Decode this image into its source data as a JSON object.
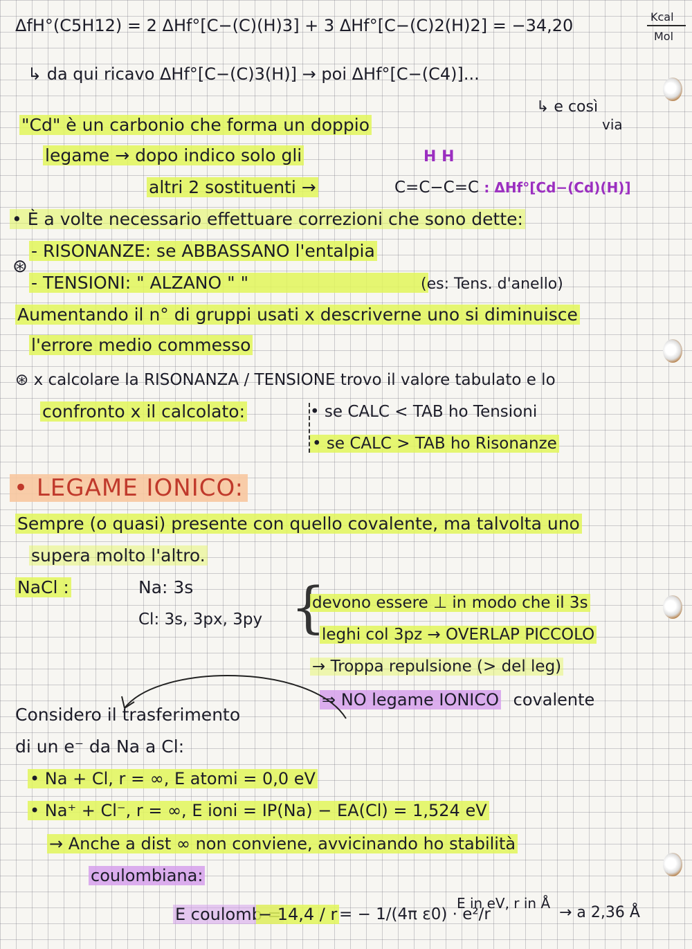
{
  "lines": {
    "l1": "ΔfH°(C5H12) = 2 ΔHf°[C−(C)(H)3] + 3 ΔHf°[C−(C)2(H)2] = −34,20",
    "l1_unit_top": "Kcal",
    "l1_unit_bottom": "Mol",
    "l2_prefix": "↳ da qui ricavo ΔHf°[C−(C)3(H)] → poi ΔHf°[C−(C4)]...",
    "l3_right": "↳ e così",
    "l3_right2": "via",
    "l3": "\"Cd\" è un carbonio che forma un doppio",
    "l4": "legame → dopo indico solo gli",
    "l5": "altri 2 sostituenti →",
    "struct_top": "H H",
    "struct": "C=C−C=C",
    "struct_formula": ": ΔHf°[Cd−(Cd)(H)]",
    "l6": "• È a volte necessario effettuare correzioni che sono dette:",
    "l7": "- RISONANZE: se ABBASSANO l'entalpia",
    "l8": "- TENSIONI: \" ALZANO \" \"",
    "l8_note": "(es: Tens. d'anello)",
    "l9": "Aumentando il n° di gruppi usati x descriverne uno si diminuisce",
    "l10": "l'errore medio commesso",
    "l11": "⊛ x calcolare la RISONANZA / TENSIONE trovo il valore tabulato e lo",
    "l12": "confronto x il calcolato:",
    "l12_a": "• se CALC < TAB ho Tensioni",
    "l12_b": "• se CALC > TAB ho Risonanze",
    "star": "⊛"
  },
  "section": {
    "title": "• LEGAME IONICO:",
    "p1": "Sempre (o quasi) presente con quello covalente, ma talvolta uno",
    "p2": "supera molto l'altro.",
    "nacl": "NaCl :",
    "na": "Na: 3s",
    "cl": "Cl: 3s, 3px, 3py",
    "r1": "devono essere ⊥ in modo che il 3s",
    "r2": "leghi col 3pz → OVERLAP PICCOLO",
    "r3": "→ Troppa repulsione (> del leg)",
    "r4": "⇒ NO legame IONICO",
    "r4_extra": "covalente",
    "consider1": "Considero il trasferimento",
    "consider2": "di un e⁻ da Na a Cl:",
    "b1": "• Na + Cl, r = ∞, E atomi = 0,0 eV",
    "b2": "• Na⁺ + Cl⁻, r = ∞, E ioni = IP(Na) − EA(Cl) = 1,524 eV",
    "b3": "→ Anche a dist ∞ non conviene, avvicinando ho stabilità",
    "b4": "coulombiana:",
    "eq_left": "E coulomb =",
    "eq_mid": "− 14,4 / r",
    "eq_right": "= − 1/(4π ε0) · e²/r",
    "eq_units": "E in eV, r in Å",
    "eq_tail": "→ a 2,36 Å"
  },
  "colors": {
    "highlight_yellow": "#e2f65a",
    "highlight_purple": "#d6a0ec",
    "title_red": "#c0392b",
    "ink": "#1c1c28"
  }
}
